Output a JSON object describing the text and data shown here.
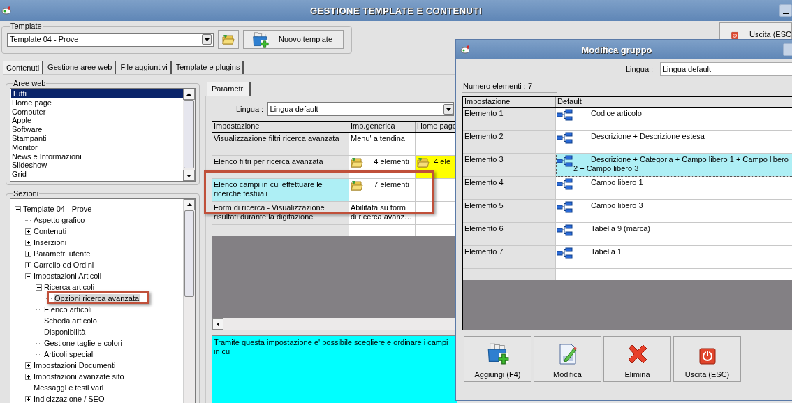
{
  "window": {
    "title": "GESTIONE TEMPLATE E CONTENUTI"
  },
  "template": {
    "label": "Template",
    "value": "Template 04 - Prove",
    "new_button": "Nuovo template"
  },
  "exit_button": {
    "label": "Uscita (ESC"
  },
  "tabs": [
    {
      "label": "Contenuti",
      "selected": true
    },
    {
      "label": "Gestione aree web",
      "selected": false
    },
    {
      "label": "File aggiuntivi",
      "selected": false
    },
    {
      "label": "Template e plugins",
      "selected": false
    }
  ],
  "aree_web": {
    "label": "Aree web",
    "items": [
      {
        "label": "Tutti",
        "selected": true
      },
      {
        "label": "Home page",
        "selected": false
      },
      {
        "label": "Computer",
        "selected": false
      },
      {
        "label": "Apple",
        "selected": false
      },
      {
        "label": "Software",
        "selected": false
      },
      {
        "label": "Stampanti",
        "selected": false
      },
      {
        "label": "Monitor",
        "selected": false
      },
      {
        "label": "News e Informazioni",
        "selected": false
      },
      {
        "label": "Slideshow",
        "selected": false
      },
      {
        "label": "Grid",
        "selected": false
      }
    ]
  },
  "sezioni": {
    "label": "Sezioni",
    "tree": [
      {
        "label": "Template 04 - Prove",
        "expanded": true,
        "selected": false,
        "children": [
          {
            "label": "Aspetto grafico",
            "selected": false
          },
          {
            "label": "Contenuti",
            "expanded": false,
            "selected": false
          },
          {
            "label": "Inserzioni",
            "expanded": false,
            "selected": false
          },
          {
            "label": "Parametri utente",
            "expanded": false,
            "selected": false
          },
          {
            "label": "Carrello ed Ordini",
            "expanded": false,
            "selected": false
          },
          {
            "label": "Impostazioni Articoli",
            "expanded": true,
            "selected": false,
            "children": [
              {
                "label": "Ricerca articoli",
                "expanded": true,
                "selected": false,
                "children": [
                  {
                    "label": "Opzioni ricerca avanzata",
                    "selected": true
                  }
                ]
              },
              {
                "label": "Elenco articoli",
                "selected": false
              },
              {
                "label": "Scheda articolo",
                "selected": false
              },
              {
                "label": "Disponibilità",
                "selected": false
              },
              {
                "label": "Gestione taglie e colori",
                "selected": false
              },
              {
                "label": "Articoli speciali",
                "selected": false
              }
            ]
          },
          {
            "label": "Impostazioni Documenti",
            "expanded": false,
            "selected": false
          },
          {
            "label": "Impostazioni avanzate sito",
            "expanded": false,
            "selected": false
          },
          {
            "label": "Messaggi e testi vari",
            "selected": false
          },
          {
            "label": "Indicizzazione / SEO",
            "expanded": false,
            "selected": false
          }
        ]
      }
    ]
  },
  "parametri": {
    "tab": "Parametri",
    "lingua_label": "Lingua :",
    "lingua_value": "Lingua default",
    "columns": [
      "Impostazione",
      "Imp.generica",
      "Home page"
    ],
    "rows": [
      {
        "selected": false,
        "cells": [
          {
            "kind": "text",
            "text": "Visualizzazione filtri ricerca avanzata",
            "highlighted": false
          },
          {
            "kind": "text",
            "text": "Menu' a tendina",
            "highlighted": false
          },
          {
            "kind": "empty",
            "highlighted": false
          }
        ]
      },
      {
        "selected": false,
        "cells": [
          {
            "kind": "text",
            "text": "Elenco filtri per ricerca avanzata",
            "highlighted": false
          },
          {
            "kind": "list",
            "text": "4 elementi",
            "highlighted": false
          },
          {
            "kind": "list",
            "text": "4 ele",
            "highlighted": true
          }
        ]
      },
      {
        "selected": true,
        "cells": [
          {
            "kind": "text",
            "text": "Elenco campi in cui effettuare le ricerche testuali",
            "highlighted": false
          },
          {
            "kind": "list",
            "text": "7 elementi",
            "highlighted": false
          },
          {
            "kind": "empty",
            "highlighted": false
          }
        ]
      },
      {
        "selected": false,
        "cells": [
          {
            "kind": "text",
            "text": "Form di ricerca - Visualizzazione risultati durante la digitazione",
            "highlighted": false
          },
          {
            "kind": "text",
            "text": "Abilitata su form di ricerca avanz…",
            "highlighted": false
          },
          {
            "kind": "empty",
            "highlighted": false
          }
        ]
      }
    ],
    "description": "Tramite questa impostazione e' possibile scegliere e ordinare i campi in cu"
  },
  "dialog": {
    "title": "Modifica gruppo",
    "lingua_label": "Lingua :",
    "lingua_value": "Lingua default",
    "count": "Numero elementi : 7",
    "columns": [
      "Impostazione",
      "Default"
    ],
    "rows": [
      {
        "name": "Elemento 1",
        "value": "Codice articolo",
        "selected": false
      },
      {
        "name": "Elemento 2",
        "value": "Descrizione + Descrizione estesa",
        "selected": false
      },
      {
        "name": "Elemento 3",
        "value": "Descrizione + Categoria + Campo libero 1 + Campo libero 2 + Campo libero 3",
        "selected": true
      },
      {
        "name": "Elemento 4",
        "value": "Campo libero 1",
        "selected": false
      },
      {
        "name": "Elemento 5",
        "value": "Campo libero 3",
        "selected": false
      },
      {
        "name": "Elemento 6",
        "value": "Tabella 9 (marca)",
        "selected": false
      },
      {
        "name": "Elemento 7",
        "value": "Tabella 1",
        "selected": false
      }
    ],
    "buttons": [
      {
        "kind": "add",
        "label": "Aggiungi (F4)"
      },
      {
        "kind": "edit",
        "label": "Modifica"
      },
      {
        "kind": "delete",
        "label": "Elimina"
      },
      {
        "kind": "exit",
        "label": "Uscita (ESC)"
      }
    ]
  }
}
